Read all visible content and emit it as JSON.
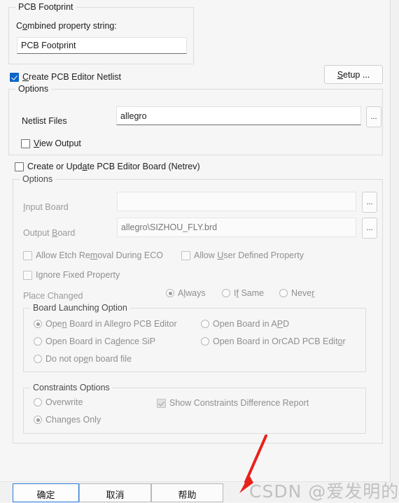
{
  "colors": {
    "background": "#f6f6f6",
    "accent_checkbox": "#0a64c8",
    "focus_border": "#2a7ad4",
    "annotation_arrow": "#e8211b",
    "watermark": "#787878"
  },
  "footprint_group": {
    "legend": "PCB Footprint",
    "combined_label": "Combined property string:",
    "combined_value": "PCB Footprint",
    "combined_placeholder": "PCB Footprint"
  },
  "netlist": {
    "checkbox_label": "Create PCB Editor Netlist",
    "checkbox_checked": true,
    "setup_button": "Setup ...",
    "options_legend": "Options",
    "netlist_files_label": "Netlist Files",
    "netlist_files_value": "allegro",
    "netlist_files_placeholder": "allegro",
    "browse_label": "...",
    "view_output_label": "View Output",
    "view_output_checked": false
  },
  "netrev": {
    "checkbox_label": "Create or Update PCB Editor Board (Netrev)",
    "checkbox_checked": false,
    "options_legend": "Options",
    "input_board_label": "Input Board",
    "input_board_value": "",
    "output_board_label": "Output Board",
    "output_board_value": "allegro\\SIZHOU_FLY.brd",
    "browse_label": "...",
    "allow_etch_removal_label": "Allow Etch Removal During ECO",
    "allow_etch_removal_checked": false,
    "allow_user_defined_label": "Allow User Defined Property",
    "allow_user_defined_checked": false,
    "ignore_fixed_label": "Ignore Fixed Property",
    "ignore_fixed_checked": false,
    "place_changed_label": "Place Changed",
    "place_changed_options": [
      {
        "label": "Always",
        "selected": true
      },
      {
        "label": "If Same",
        "selected": false
      },
      {
        "label": "Never",
        "selected": false
      }
    ]
  },
  "board_launching": {
    "legend": "Board Launching Option",
    "options": [
      {
        "label": "Open Board in Allegro PCB Editor",
        "selected": true
      },
      {
        "label": "Open Board in APD",
        "selected": false
      },
      {
        "label": "Open Board in Cadence SiP",
        "selected": false
      },
      {
        "label": "Open Board in OrCAD PCB Editor",
        "selected": false
      },
      {
        "label": "Do not open board file",
        "selected": false
      }
    ]
  },
  "constraints": {
    "legend": "Constraints Options",
    "options": [
      {
        "label": "Overwrite",
        "selected": false
      },
      {
        "label": "Changes  Only",
        "selected": true
      }
    ],
    "show_report_label": "Show Constraints Difference Report",
    "show_report_checked": true
  },
  "footer": {
    "ok_label": "确定",
    "cancel_label": "取消",
    "help_label": "帮助"
  },
  "annotation": {
    "watermark_text": "CSDN @爱发明的小兴",
    "arrow_name": "red-arrow-pointing-to-ok-button"
  }
}
